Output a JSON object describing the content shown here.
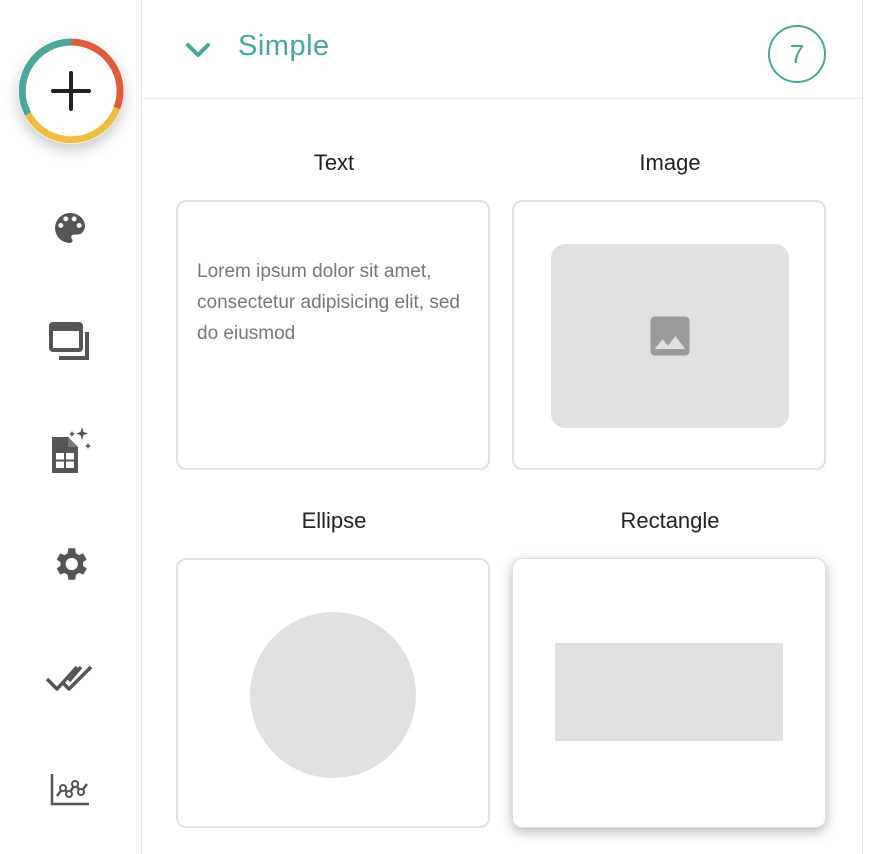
{
  "rail": {
    "items": [
      "add",
      "palette",
      "layers",
      "ai-sheet",
      "settings",
      "done-all",
      "chart"
    ]
  },
  "header": {
    "title": "Simple",
    "count": "7"
  },
  "cards": [
    {
      "label": "Text",
      "sample": "Lorem ipsum dolor sit amet, consectetur adipisicing elit, sed do eiusmod"
    },
    {
      "label": "Image"
    },
    {
      "label": "Ellipse"
    },
    {
      "label": "Rectangle"
    }
  ],
  "colors": {
    "accent": "#4aa79a",
    "fab_red": "#e05a3c",
    "fab_yellow": "#f0bd43",
    "fab_teal": "#4aa79a",
    "placeholder": "#e0e0e0",
    "icon": "#555555"
  }
}
